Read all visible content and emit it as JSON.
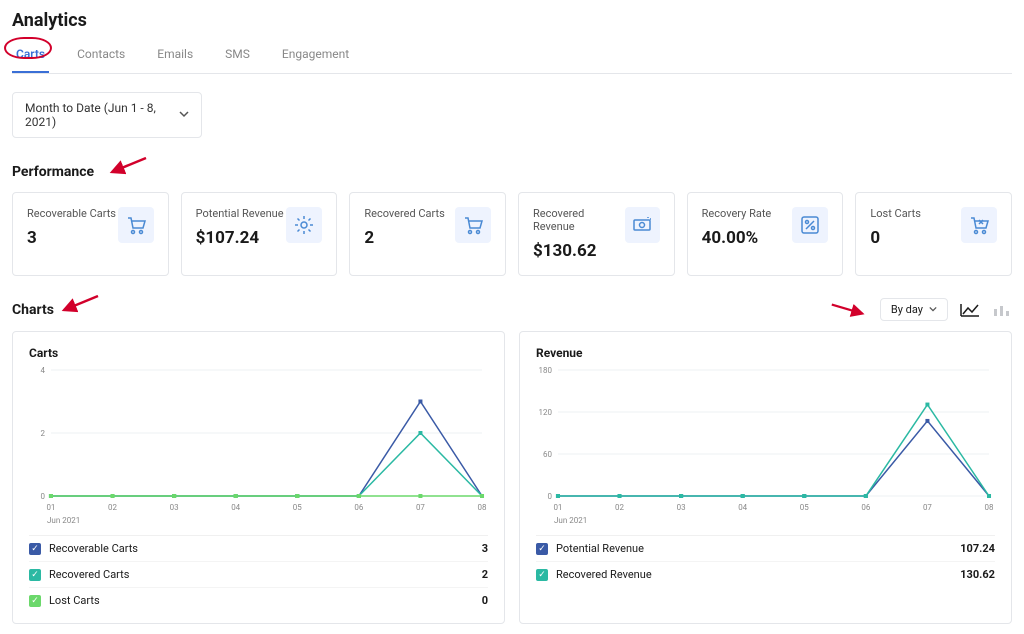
{
  "page_title": "Analytics",
  "tabs": [
    "Carts",
    "Contacts",
    "Emails",
    "SMS",
    "Engagement"
  ],
  "active_tab_index": 0,
  "date_range": "Month to Date (Jun 1 - 8, 2021)",
  "section_performance": "Performance",
  "section_charts": "Charts",
  "byday_label": "By day",
  "performance": [
    {
      "label": "Recoverable Carts",
      "value": "3",
      "icon": "cart-icon"
    },
    {
      "label": "Potential Revenue",
      "value": "$107.24",
      "icon": "gear-icon"
    },
    {
      "label": "Recovered Carts",
      "value": "2",
      "icon": "cart-icon"
    },
    {
      "label": "Recovered Revenue",
      "value": "$130.62",
      "icon": "money-icon"
    },
    {
      "label": "Recovery Rate",
      "value": "40.00%",
      "icon": "percent-icon"
    },
    {
      "label": "Lost Carts",
      "value": "0",
      "icon": "cart-x-icon"
    }
  ],
  "charts": [
    {
      "title": "Carts",
      "x_axis_caption": "Jun 2021",
      "legend": [
        {
          "name": "Recoverable Carts",
          "color": "#3a5aa6",
          "value": "3"
        },
        {
          "name": "Recovered Carts",
          "color": "#2bb9a3",
          "value": "2"
        },
        {
          "name": "Lost Carts",
          "color": "#6bd86b",
          "value": "0"
        }
      ]
    },
    {
      "title": "Revenue",
      "x_axis_caption": "Jun 2021",
      "legend": [
        {
          "name": "Potential Revenue",
          "color": "#3a5aa6",
          "value": "107.24"
        },
        {
          "name": "Recovered Revenue",
          "color": "#2bb9a3",
          "value": "130.62"
        }
      ]
    }
  ],
  "chart_data": [
    {
      "type": "line",
      "title": "Carts",
      "xlabel": "Jun 2021",
      "ylabel": "",
      "ytick_labels": [
        0,
        2,
        4
      ],
      "ylim": [
        0,
        4
      ],
      "categories": [
        "01",
        "02",
        "03",
        "04",
        "05",
        "06",
        "07",
        "08"
      ],
      "series": [
        {
          "name": "Recoverable Carts",
          "color": "#3a5aa6",
          "values": [
            0,
            0,
            0,
            0,
            0,
            0,
            3,
            0
          ]
        },
        {
          "name": "Recovered Carts",
          "color": "#2bb9a3",
          "values": [
            0,
            0,
            0,
            0,
            0,
            0,
            2,
            0
          ]
        },
        {
          "name": "Lost Carts",
          "color": "#6bd86b",
          "values": [
            0,
            0,
            0,
            0,
            0,
            0,
            0,
            0
          ]
        }
      ]
    },
    {
      "type": "line",
      "title": "Revenue",
      "xlabel": "Jun 2021",
      "ylabel": "",
      "ytick_labels": [
        0,
        60,
        120,
        180
      ],
      "ylim": [
        0,
        180
      ],
      "categories": [
        "01",
        "02",
        "03",
        "04",
        "05",
        "06",
        "07",
        "08"
      ],
      "series": [
        {
          "name": "Potential Revenue",
          "color": "#3a5aa6",
          "values": [
            0,
            0,
            0,
            0,
            0,
            0,
            107.24,
            0
          ]
        },
        {
          "name": "Recovered Revenue",
          "color": "#2bb9a3",
          "values": [
            0,
            0,
            0,
            0,
            0,
            0,
            130.62,
            0
          ]
        }
      ]
    }
  ],
  "colors": {
    "accent": "#3a6fd6",
    "icon_bg": "#eef3fe",
    "icon_fg": "#4a8ad4",
    "annotation": "#d2002b"
  }
}
